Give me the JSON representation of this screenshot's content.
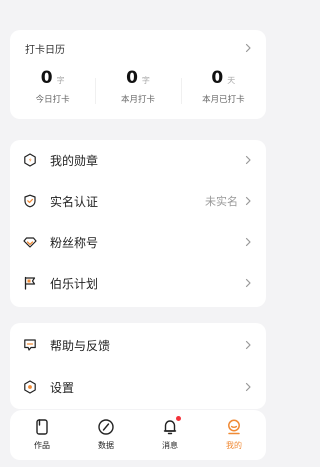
{
  "checkin": {
    "title": "打卡日历",
    "stats": [
      {
        "value": "0",
        "unit": "字",
        "label": "今日打卡"
      },
      {
        "value": "0",
        "unit": "字",
        "label": "本月打卡"
      },
      {
        "value": "0",
        "unit": "天",
        "label": "本月已打卡"
      }
    ]
  },
  "menu": {
    "medals": "我的勋章",
    "verify": "实名认证",
    "verify_status": "未实名",
    "fan_title": "粉丝称号",
    "bole_plan": "伯乐计划",
    "help": "帮助与反馈",
    "settings": "设置"
  },
  "tabs": [
    {
      "label": "作品",
      "icon": "works-icon"
    },
    {
      "label": "数据",
      "icon": "compass-icon"
    },
    {
      "label": "消息",
      "icon": "bell-icon"
    },
    {
      "label": "我的",
      "icon": "profile-icon"
    }
  ],
  "colors": {
    "accent": "#f08a35",
    "badge": "#f3323a",
    "background": "#f3f3f5"
  }
}
